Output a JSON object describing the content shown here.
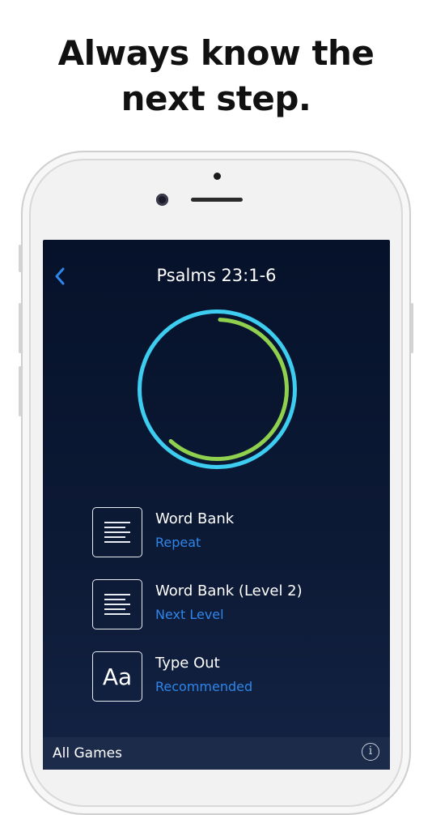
{
  "headline": {
    "line1": "Always know the",
    "line2": "next step."
  },
  "nav": {
    "title": "Psalms 23:1-6",
    "back_icon": "chevron-left-icon"
  },
  "progress": {
    "outer_color": "#3dcdf1",
    "inner_color": "#8fd14f",
    "inner_fraction": 0.61
  },
  "games": [
    {
      "icon": "word-bank-icon",
      "name": "Word Bank",
      "action": "Repeat"
    },
    {
      "icon": "word-bank-icon",
      "name": "Word Bank (Level 2)",
      "action": "Next Level"
    },
    {
      "icon": "type-out-icon",
      "icon_text": "Aa",
      "name": "Type Out",
      "action": "Recommended"
    }
  ],
  "bottom_bar": {
    "label": "All Games",
    "info_icon": "info-icon",
    "info_glyph": "i"
  },
  "colors": {
    "accent": "#2e86ea",
    "screen_bg": "#0b1833"
  }
}
